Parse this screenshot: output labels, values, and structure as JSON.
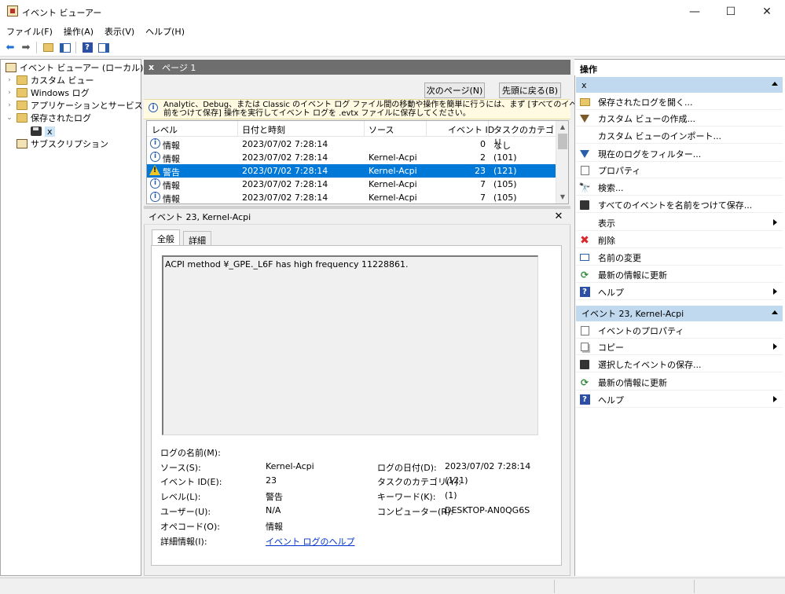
{
  "window": {
    "title": "イベント ビューアー",
    "minimize_glyph": "—",
    "maximize_glyph": "☐",
    "close_glyph": "✕"
  },
  "menu": [
    "ファイル(F)",
    "操作(A)",
    "表示(V)",
    "ヘルプ(H)"
  ],
  "toolbar_icons": [
    "back-arrow-icon",
    "forward-arrow-icon",
    "folder-up-icon",
    "show-hide-console-tree-icon",
    "help-icon",
    "show-hide-action-pane-icon"
  ],
  "tree": {
    "root": "イベント ビューアー (ローカル)",
    "items": [
      {
        "label": "カスタム ビュー",
        "chevron": "›"
      },
      {
        "label": "Windows ログ",
        "chevron": "›"
      },
      {
        "label": "アプリケーションとサービス ログ",
        "chevron": "›"
      },
      {
        "label": "保存されたログ",
        "chevron": "⌄"
      }
    ],
    "saved_child": "x",
    "subscription": "サブスクリプション"
  },
  "center": {
    "header_x": "x",
    "header_page": "ページ 1",
    "next_page_button": "次のページ(N)",
    "first_page_button": "先頭に戻る(B)",
    "info_line1": "Analytic、Debug、または Classic のイベント ログ ファイル間の移動や操作を簡単に行うには、まず [すべてのイベントを名",
    "info_line2": "前をつけて保存] 操作を実行してイベント ログを .evtx ファイルに保存してください。"
  },
  "grid": {
    "columns": [
      "レベル",
      "日付と時刻",
      "ソース",
      "イベント ID",
      "タスクのカテゴリ"
    ],
    "rows": [
      {
        "level": "情報",
        "datetime": "2023/07/02 7:28:14",
        "source": "",
        "event_id": "0",
        "category": "なし",
        "type": "info"
      },
      {
        "level": "情報",
        "datetime": "2023/07/02 7:28:14",
        "source": "Kernel-Acpi",
        "event_id": "2",
        "category": "(101)",
        "type": "info"
      },
      {
        "level": "警告",
        "datetime": "2023/07/02 7:28:14",
        "source": "Kernel-Acpi",
        "event_id": "23",
        "category": "(121)",
        "type": "warning"
      },
      {
        "level": "情報",
        "datetime": "2023/07/02 7:28:14",
        "source": "Kernel-Acpi",
        "event_id": "7",
        "category": "(105)",
        "type": "info"
      },
      {
        "level": "情報",
        "datetime": "2023/07/02 7:28:14",
        "source": "Kernel-Acpi",
        "event_id": "7",
        "category": "(105)",
        "type": "info"
      }
    ]
  },
  "detail": {
    "title": "イベント 23, Kernel-Acpi",
    "close_glyph": "✕",
    "tabs": [
      "全般",
      "詳細"
    ],
    "message": "ACPI method ¥_GPE._L6F has high frequency 11228861.",
    "labels": {
      "log_name": "ログの名前(M):",
      "source": "ソース(S):",
      "event_id": "イベント ID(E):",
      "level": "レベル(L):",
      "user": "ユーザー(U):",
      "opcode": "オペコード(O):",
      "more_info": "詳細情報(I):",
      "logged": "ログの日付(D):",
      "task_category": "タスクのカテゴリ(Y):",
      "keywords": "キーワード(K):",
      "computer": "コンピューター(R):"
    },
    "values": {
      "source": "Kernel-Acpi",
      "event_id": "23",
      "level": "警告",
      "user": "N/A",
      "opcode": "情報",
      "more_info_link": "イベント ログのヘルプ",
      "logged": "2023/07/02 7:28:14",
      "task_category": "(121)",
      "keywords": "(1)",
      "computer": "DESKTOP-AN0QG6S"
    }
  },
  "actions": {
    "title": "操作",
    "section1": "x",
    "items1": [
      {
        "label": "保存されたログを開く...",
        "icon": "open-folder-icon",
        "submenu": false
      },
      {
        "label": "カスタム ビューの作成...",
        "icon": "filter-create-icon",
        "submenu": false
      },
      {
        "label": "カスタム ビューのインポート...",
        "icon": "",
        "submenu": false
      },
      {
        "label": "現在のログをフィルター...",
        "icon": "filter-icon",
        "submenu": false
      },
      {
        "label": "プロパティ",
        "icon": "properties-icon",
        "submenu": false
      },
      {
        "label": "検索...",
        "icon": "binoculars-icon",
        "submenu": false
      },
      {
        "label": "すべてのイベントを名前をつけて保存...",
        "icon": "save-icon",
        "submenu": false
      },
      {
        "label": "表示",
        "icon": "",
        "submenu": true
      },
      {
        "label": "削除",
        "icon": "delete-icon",
        "submenu": false
      },
      {
        "label": "名前の変更",
        "icon": "rename-icon",
        "submenu": false
      },
      {
        "label": "最新の情報に更新",
        "icon": "refresh-icon",
        "submenu": false
      },
      {
        "label": "ヘルプ",
        "icon": "help-icon",
        "submenu": true
      }
    ],
    "section2": "イベント 23, Kernel-Acpi",
    "items2": [
      {
        "label": "イベントのプロパティ",
        "icon": "event-properties-icon",
        "submenu": false
      },
      {
        "label": "コピー",
        "icon": "copy-icon",
        "submenu": true
      },
      {
        "label": "選択したイベントの保存...",
        "icon": "save-icon",
        "submenu": false
      },
      {
        "label": "最新の情報に更新",
        "icon": "refresh-icon",
        "submenu": false
      },
      {
        "label": "ヘルプ",
        "icon": "help-icon",
        "submenu": true
      }
    ]
  },
  "colors": {
    "selection": "#0078d7",
    "section_header": "#c1d9ef",
    "info_strip": "#fffae1",
    "link": "#0033cc",
    "delete_red": "#d9262c",
    "help_blue": "#2c4fa3"
  }
}
